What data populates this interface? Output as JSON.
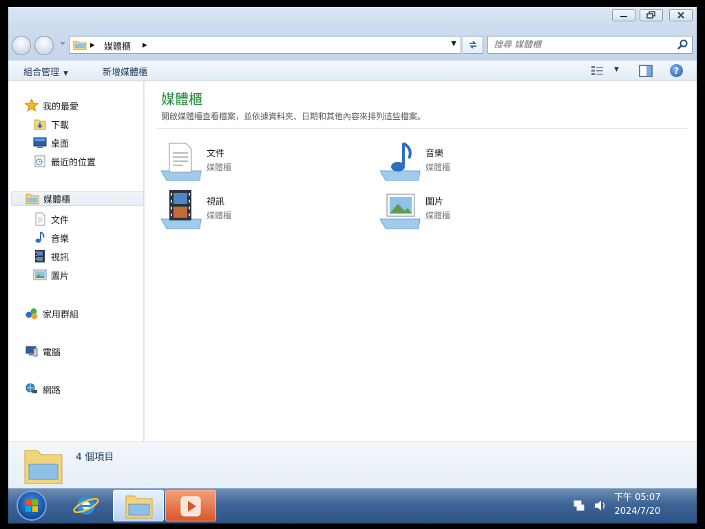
{
  "window": {
    "min_label": "",
    "address": {
      "crumbs": [
        "媒體櫃"
      ]
    },
    "search": {
      "placeholder": "搜尋 媒體櫃"
    }
  },
  "toolbar": {
    "organize": "組合管理",
    "new_library": "新增媒體櫃"
  },
  "sidebar": {
    "favorites": "我的最愛",
    "favorites_items": [
      "下載",
      "桌面",
      "最近的位置"
    ],
    "libraries": "媒體櫃",
    "libraries_items": [
      "文件",
      "音樂",
      "視訊",
      "圖片"
    ],
    "homegroup": "家用群組",
    "computer": "電腦",
    "network": "網路"
  },
  "content": {
    "title": "媒體櫃",
    "description": "開啟媒體櫃查看檔案，並依據資料夾、日期和其他內容來排列這些檔案。",
    "libraries": [
      {
        "name": "文件",
        "type": "媒體櫃",
        "icon": "documents-library-icon"
      },
      {
        "name": "音樂",
        "type": "媒體櫃",
        "icon": "music-library-icon"
      },
      {
        "name": "視訊",
        "type": "媒體櫃",
        "icon": "videos-library-icon"
      },
      {
        "name": "圖片",
        "type": "媒體櫃",
        "icon": "pictures-library-icon"
      }
    ]
  },
  "details": {
    "count": "4 個項目"
  },
  "taskbar": {
    "clock_time": "下午 05:07",
    "clock_date": "2024/7/20"
  },
  "colors": {
    "title_green": "#1e8a34",
    "taskbar_blue": "#3e6596"
  }
}
